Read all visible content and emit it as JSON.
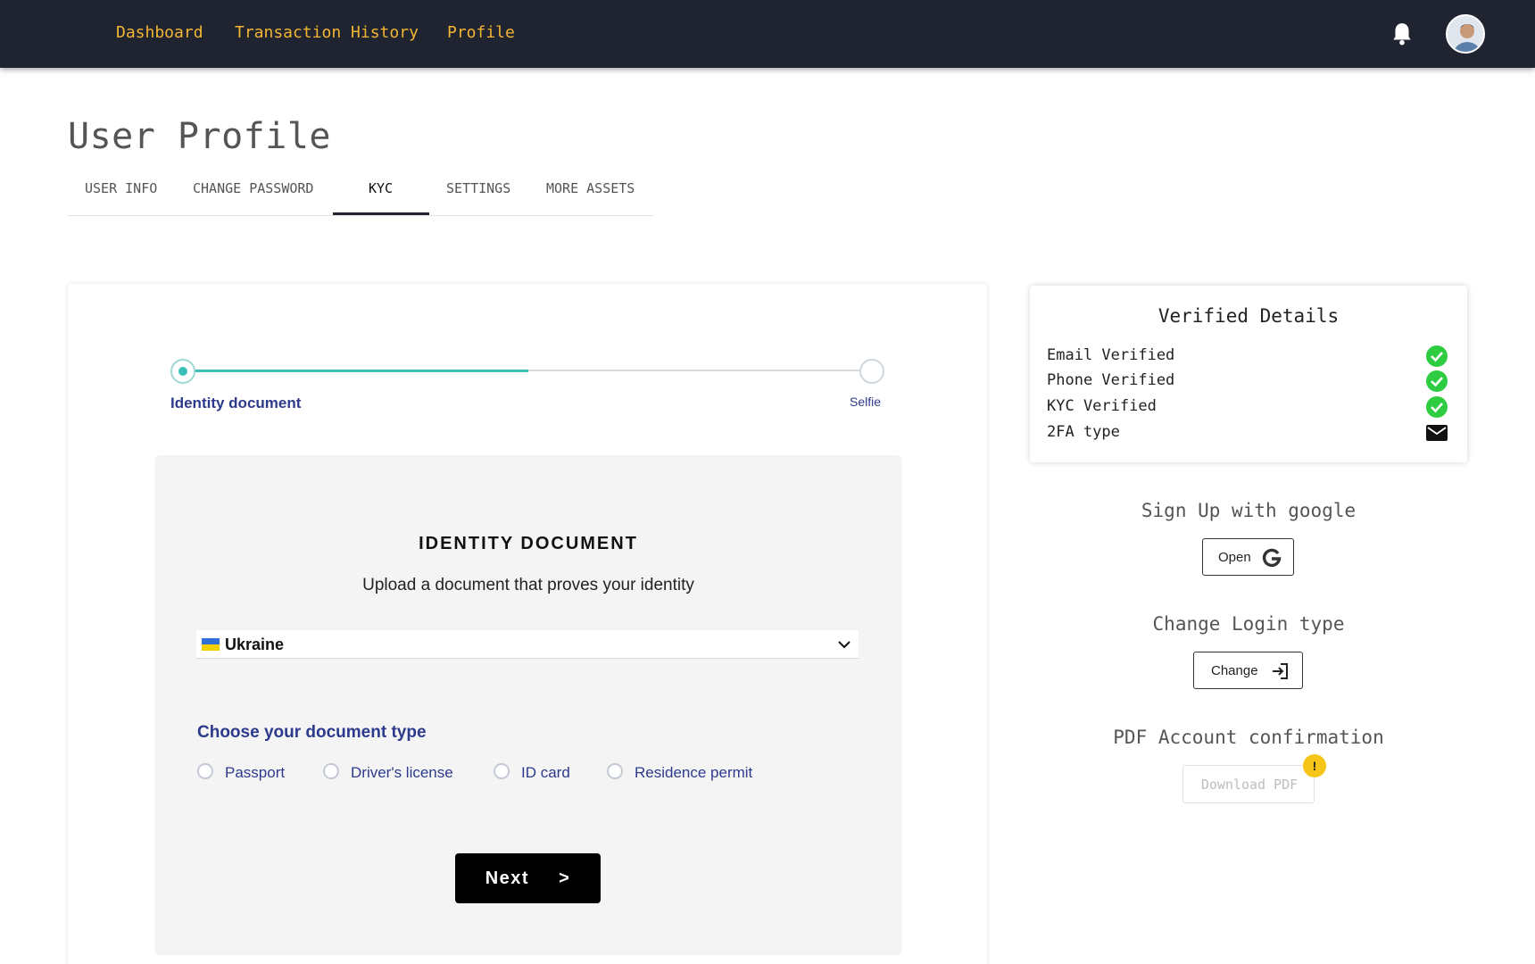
{
  "nav": {
    "links": [
      "Dashboard",
      "Transaction History",
      "Profile"
    ]
  },
  "page": {
    "title": "User Profile",
    "tabs": [
      "USER INFO",
      "CHANGE PASSWORD",
      "KYC",
      "SETTINGS",
      "MORE ASSETS"
    ],
    "active_tab": "KYC"
  },
  "kyc": {
    "steps": [
      "Identity document",
      "Selfie"
    ],
    "progress_fraction": 0.5,
    "heading": "IDENTITY DOCUMENT",
    "subheading": "Upload a document that proves your identity",
    "country": "Ukraine",
    "choose_label": "Choose your document type",
    "document_types": [
      "Passport",
      "Driver's license",
      "ID card",
      "Residence permit"
    ],
    "next_label": "Next",
    "next_arrow": ">"
  },
  "verified": {
    "title": "Verified Details",
    "rows": [
      {
        "label": "Email Verified",
        "icon": "check-circle-icon"
      },
      {
        "label": "Phone Verified",
        "icon": "check-circle-icon"
      },
      {
        "label": "KYC Verified",
        "icon": "check-circle-icon"
      },
      {
        "label": "2FA type",
        "icon": "mail-icon"
      }
    ]
  },
  "side": {
    "google_heading": "Sign Up with google",
    "google_button": "Open",
    "login_heading": "Change Login type",
    "login_button": "Change",
    "pdf_heading": "PDF Account confirmation",
    "pdf_button": "Download PDF",
    "pdf_badge": "!"
  },
  "colors": {
    "nav_bg": "#1f2430",
    "nav_link": "#f2b632",
    "accent_teal": "#3bbfb6",
    "accent_navy": "#2d3a8c",
    "check_green": "#2ecc40",
    "warning_yellow": "#f5c518"
  }
}
